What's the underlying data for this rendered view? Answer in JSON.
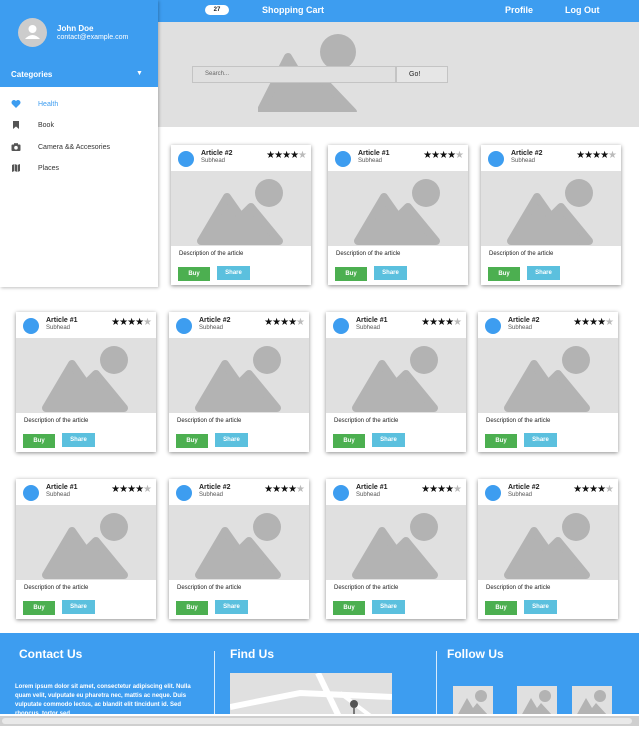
{
  "topbar": {
    "cart_count": "27",
    "cart_label": "Shopping Cart",
    "profile_label": "Profile",
    "logout_label": "Log Out"
  },
  "hero": {
    "search_placeholder": "Search...",
    "go_label": "Go!"
  },
  "sidebar": {
    "user_name": "John Doe",
    "user_email": "contact@example.com",
    "categories_label": "Categories",
    "items": [
      {
        "label": "Health",
        "icon": "heart-icon"
      },
      {
        "label": "Book",
        "icon": "bookmark-icon"
      },
      {
        "label": "Camera && Accesories",
        "icon": "camera-icon"
      },
      {
        "label": "Places",
        "icon": "map-icon"
      }
    ]
  },
  "cards": [
    {
      "title": "Article #2",
      "subhead": "Subhead",
      "rating": 4,
      "description": "Description of the article",
      "buy": "Buy",
      "share": "Share"
    },
    {
      "title": "Article #1",
      "subhead": "Subhead",
      "rating": 4,
      "description": "Description of the article",
      "buy": "Buy",
      "share": "Share"
    },
    {
      "title": "Article #2",
      "subhead": "Subhead",
      "rating": 4,
      "description": "Description of the article",
      "buy": "Buy",
      "share": "Share"
    },
    {
      "title": "Article #1",
      "subhead": "Subhead",
      "rating": 4,
      "description": "Description of the article",
      "buy": "Buy",
      "share": "Share"
    },
    {
      "title": "Article #2",
      "subhead": "Subhead",
      "rating": 4,
      "description": "Description of the article",
      "buy": "Buy",
      "share": "Share"
    },
    {
      "title": "Article #1",
      "subhead": "Subhead",
      "rating": 4,
      "description": "Description of the article",
      "buy": "Buy",
      "share": "Share"
    },
    {
      "title": "Article #2",
      "subhead": "Subhead",
      "rating": 4,
      "description": "Description of the article",
      "buy": "Buy",
      "share": "Share"
    },
    {
      "title": "Article #1",
      "subhead": "Subhead",
      "rating": 4,
      "description": "Description of the article",
      "buy": "Buy",
      "share": "Share"
    },
    {
      "title": "Article #2",
      "subhead": "Subhead",
      "rating": 4,
      "description": "Description of the article",
      "buy": "Buy",
      "share": "Share"
    },
    {
      "title": "Article #1",
      "subhead": "Subhead",
      "rating": 4,
      "description": "Description of the article",
      "buy": "Buy",
      "share": "Share"
    },
    {
      "title": "Article #2",
      "subhead": "Subhead",
      "rating": 4,
      "description": "Description of the article",
      "buy": "Buy",
      "share": "Share"
    }
  ],
  "footer": {
    "contact_title": "Contact Us",
    "find_title": "Find Us",
    "follow_title": "Follow Us",
    "contact_text": "Lorem ipsum dolor sit amet, consectetur adipiscing elit. Nulla quam velit, vulputate eu pharetra nec, mattis ac neque. Duis vulputate commodo lectus, ac blandit elit tincidunt id. Sed rhoncus, tortor sed"
  },
  "colors": {
    "primary": "#3d9df0",
    "buy": "#4caf50",
    "share": "#5bc0de",
    "placeholder": "#e0e0e0"
  }
}
